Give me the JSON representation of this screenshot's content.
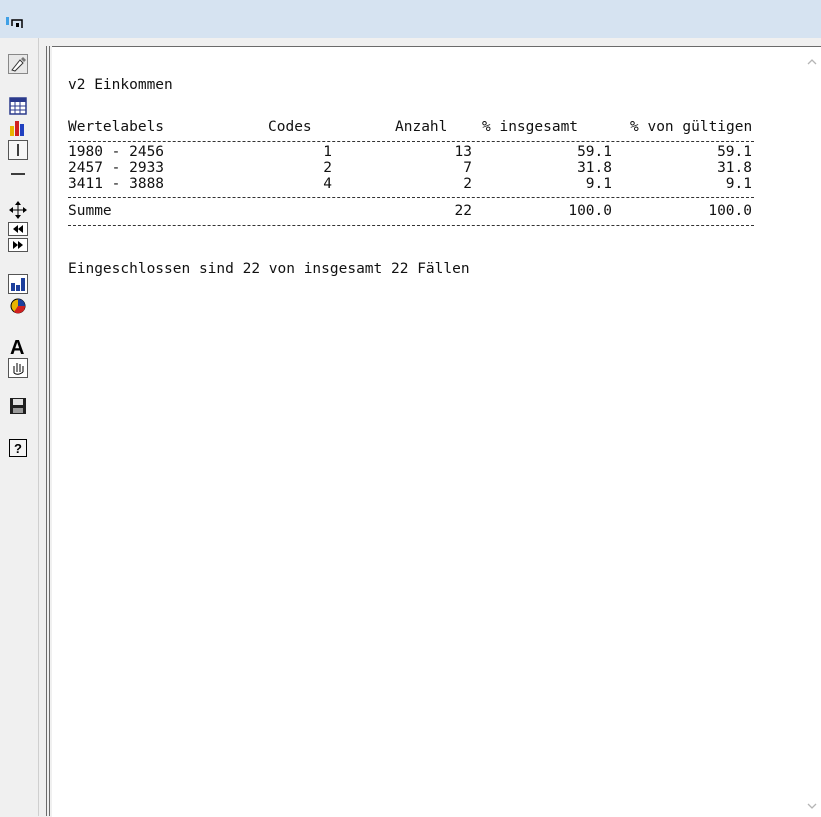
{
  "window": {
    "icon": "chart-window-icon"
  },
  "toolbar": {
    "buttons": [
      {
        "name": "pen-edit-icon"
      },
      {
        "name": "table-view-icon"
      },
      {
        "name": "bar-chart-color-icon"
      },
      {
        "name": "vertical-line-icon"
      },
      {
        "name": "horizontal-line-icon"
      },
      {
        "name": "move-arrows-icon"
      },
      {
        "name": "rewind-icon"
      },
      {
        "name": "fast-forward-icon"
      },
      {
        "name": "bar-chart-icon"
      },
      {
        "name": "pie-chart-icon"
      },
      {
        "name": "text-icon"
      },
      {
        "name": "hand-icon"
      },
      {
        "name": "save-icon"
      },
      {
        "name": "help-icon"
      }
    ]
  },
  "output": {
    "variable_title": "v2 Einkommen",
    "headers": {
      "wertelabels": "Wertelabels",
      "codes": "Codes",
      "anzahl": "Anzahl",
      "pct_insgesamt": "% insgesamt",
      "pct_gueltig": "% von gültigen"
    },
    "rows": [
      {
        "label": "1980 - 2456",
        "code": "1",
        "count": "13",
        "pct_total": "59.1",
        "pct_valid": "59.1"
      },
      {
        "label": "2457 - 2933",
        "code": "2",
        "count": "7",
        "pct_total": "31.8",
        "pct_valid": "31.8"
      },
      {
        "label": "3411 - 3888",
        "code": "4",
        "count": "2",
        "pct_total": "9.1",
        "pct_valid": "9.1"
      }
    ],
    "sum": {
      "label": "Summe",
      "count": "22",
      "pct_total": "100.0",
      "pct_valid": "100.0"
    },
    "note": "Eingeschlossen sind 22 von insgesamt 22 Fällen"
  }
}
